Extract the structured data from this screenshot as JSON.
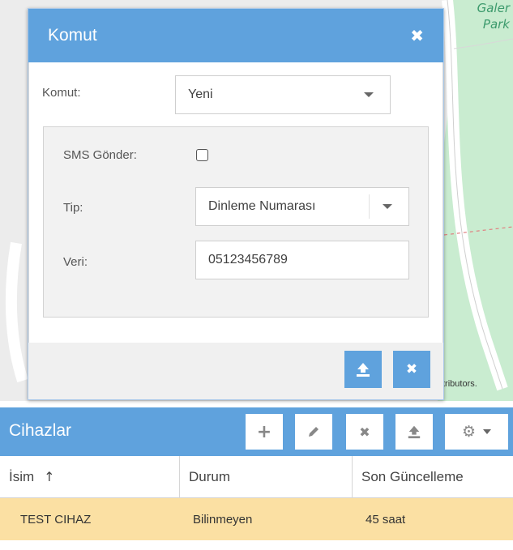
{
  "map": {
    "park_label_line1": "Galer",
    "park_label_line2": "Park",
    "attribution": "tributors."
  },
  "dialog": {
    "title": "Komut",
    "command_label": "Komut:",
    "command_value": "Yeni",
    "sms_label": "SMS Gönder:",
    "sms_checked": false,
    "type_label": "Tip:",
    "type_value": "Dinleme Numarası",
    "data_label": "Veri:",
    "data_value": "05123456789"
  },
  "devices": {
    "title": "Cihazlar",
    "toolbar": [
      "add-icon",
      "edit-icon",
      "remove-icon",
      "command-icon",
      "settings-icon"
    ],
    "columns": [
      "İsim",
      "Durum",
      "Son Güncelleme"
    ],
    "sort_column": "İsim",
    "rows": [
      {
        "name": "TEST CIHAZ",
        "status": "Bilinmeyen",
        "last_update": "45 saat"
      }
    ]
  },
  "colors": {
    "accent": "#5fa2dd",
    "selected_row": "#fbe0a3",
    "park_green": "#c9ecd0"
  }
}
